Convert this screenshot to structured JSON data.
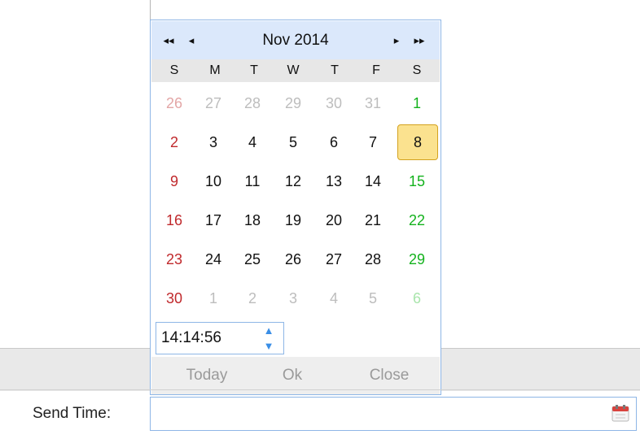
{
  "calendar": {
    "month_title": "Nov 2014",
    "nav": {
      "prev_year": "◂◂",
      "prev_month": "◂",
      "next_month": "▸",
      "next_year": "▸▸"
    },
    "weekdays": [
      "S",
      "M",
      "T",
      "W",
      "T",
      "F",
      "S"
    ],
    "weeks": [
      [
        "26",
        "27",
        "28",
        "29",
        "30",
        "31",
        "1"
      ],
      [
        "2",
        "3",
        "4",
        "5",
        "6",
        "7",
        "8"
      ],
      [
        "9",
        "10",
        "11",
        "12",
        "13",
        "14",
        "15"
      ],
      [
        "16",
        "17",
        "18",
        "19",
        "20",
        "21",
        "22"
      ],
      [
        "23",
        "24",
        "25",
        "26",
        "27",
        "28",
        "29"
      ],
      [
        "30",
        "1",
        "2",
        "3",
        "4",
        "5",
        "6"
      ]
    ],
    "selected_day": "8",
    "time_value": "14:14:56",
    "buttons": {
      "today": "Today",
      "ok": "Ok",
      "close": "Close"
    },
    "colors": {
      "header_bg": "#dbe8fb",
      "selected_bg": "#fbe28f",
      "sunday": "#c0292c",
      "saturday": "#14b21d",
      "border": "#8eb6e6"
    }
  },
  "form": {
    "send_time_label": "Send Time:",
    "send_time_value": "",
    "calendar_icon": "calendar-icon"
  }
}
